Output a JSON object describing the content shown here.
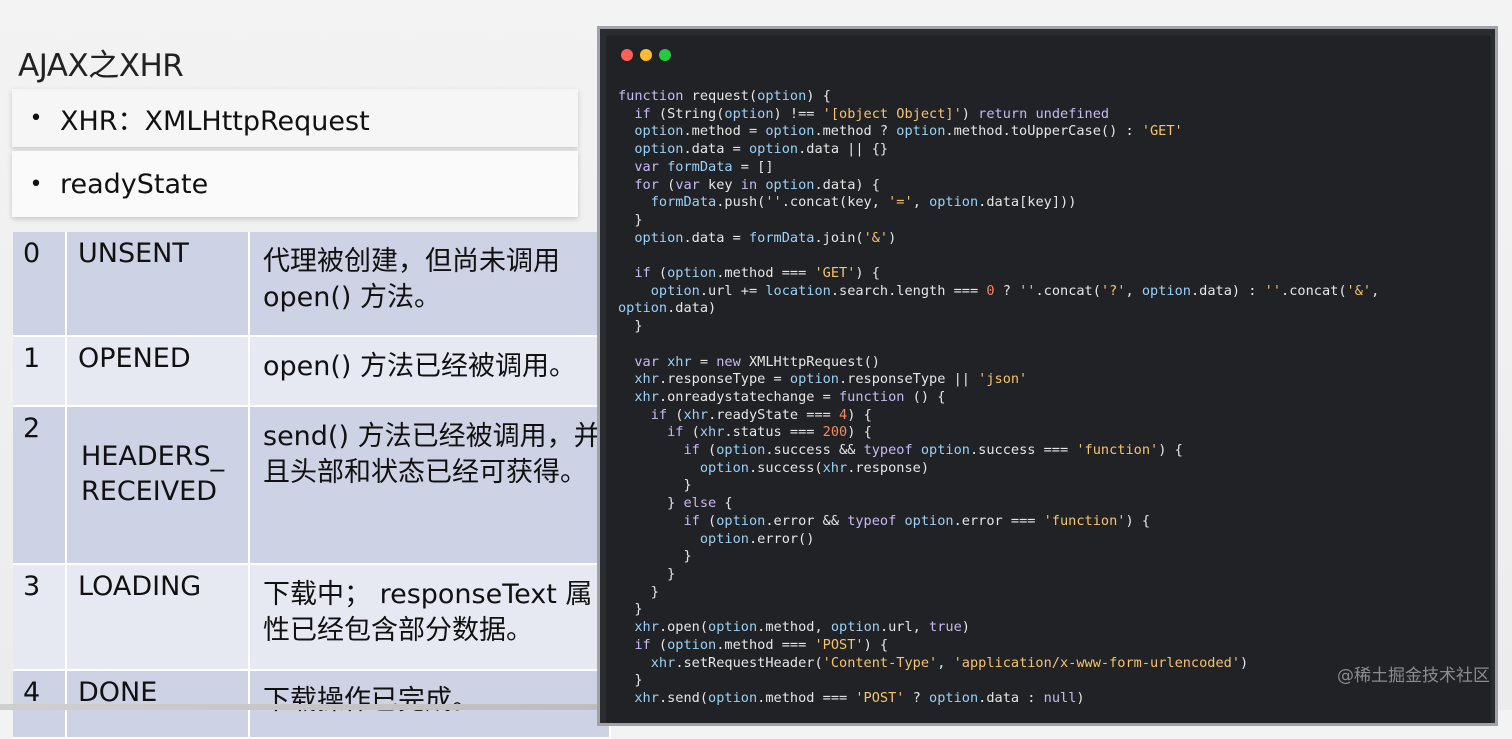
{
  "slide": {
    "title": "AJAX之XHR",
    "bullets": [
      {
        "marker": "•",
        "text": "XHR：XMLHttpRequest"
      },
      {
        "marker": "•",
        "text": "readyState"
      }
    ]
  },
  "ready_states": [
    {
      "value": "0",
      "name": "UNSENT",
      "desc": "代理被创建，但尚未调用 open() 方法。"
    },
    {
      "value": "1",
      "name": "OPENED",
      "desc": "open() 方法已经被调用。"
    },
    {
      "value": "2",
      "name": "HEADERS_ RECEIVED",
      "desc": "send() 方法已经被调用，并且头部和状态已经可获得。"
    },
    {
      "value": "3",
      "name": "LOADING",
      "desc": "下载中； responseText 属性已经包含部分数据。"
    },
    {
      "value": "4",
      "name": "DONE",
      "desc": "下载操作已完成。"
    }
  ],
  "code_window": {
    "lines": [
      "function request(option) {",
      "  if (String(option) !== '[object Object]') return undefined",
      "  option.method = option.method ? option.method.toUpperCase() : 'GET'",
      "  option.data = option.data || {}",
      "  var formData = []",
      "  for (var key in option.data) {",
      "    formData.push(''.concat(key, '=', option.data[key]))",
      "  }",
      "  option.data = formData.join('&')",
      "",
      "  if (option.method === 'GET') {",
      "    option.url += location.search.length === 0 ? ''.concat('?', option.data) : ''.concat('&',",
      "option.data)",
      "  }",
      "",
      "  var xhr = new XMLHttpRequest()",
      "  xhr.responseType = option.responseType || 'json'",
      "  xhr.onreadystatechange = function () {",
      "    if (xhr.readyState === 4) {",
      "      if (xhr.status === 200) {",
      "        if (option.success && typeof option.success === 'function') {",
      "          option.success(xhr.response)",
      "        }",
      "      } else {",
      "        if (option.error && typeof option.error === 'function') {",
      "          option.error()",
      "        }",
      "      }",
      "    }",
      "  }",
      "  xhr.open(option.method, option.url, true)",
      "  if (option.method === 'POST') {",
      "    xhr.setRequestHeader('Content-Type', 'application/x-www-form-urlencoded')",
      "  }",
      "  xhr.send(option.method === 'POST' ? option.data : null)"
    ]
  },
  "watermark": "@稀土掘金技术社区",
  "colors": {
    "table_dark": "#cdd2e4",
    "table_light": "#e7e9f2",
    "code_bg": "#212225",
    "traffic_red": "#fe5f57",
    "traffic_yellow": "#febc2e",
    "traffic_green": "#28c840"
  }
}
